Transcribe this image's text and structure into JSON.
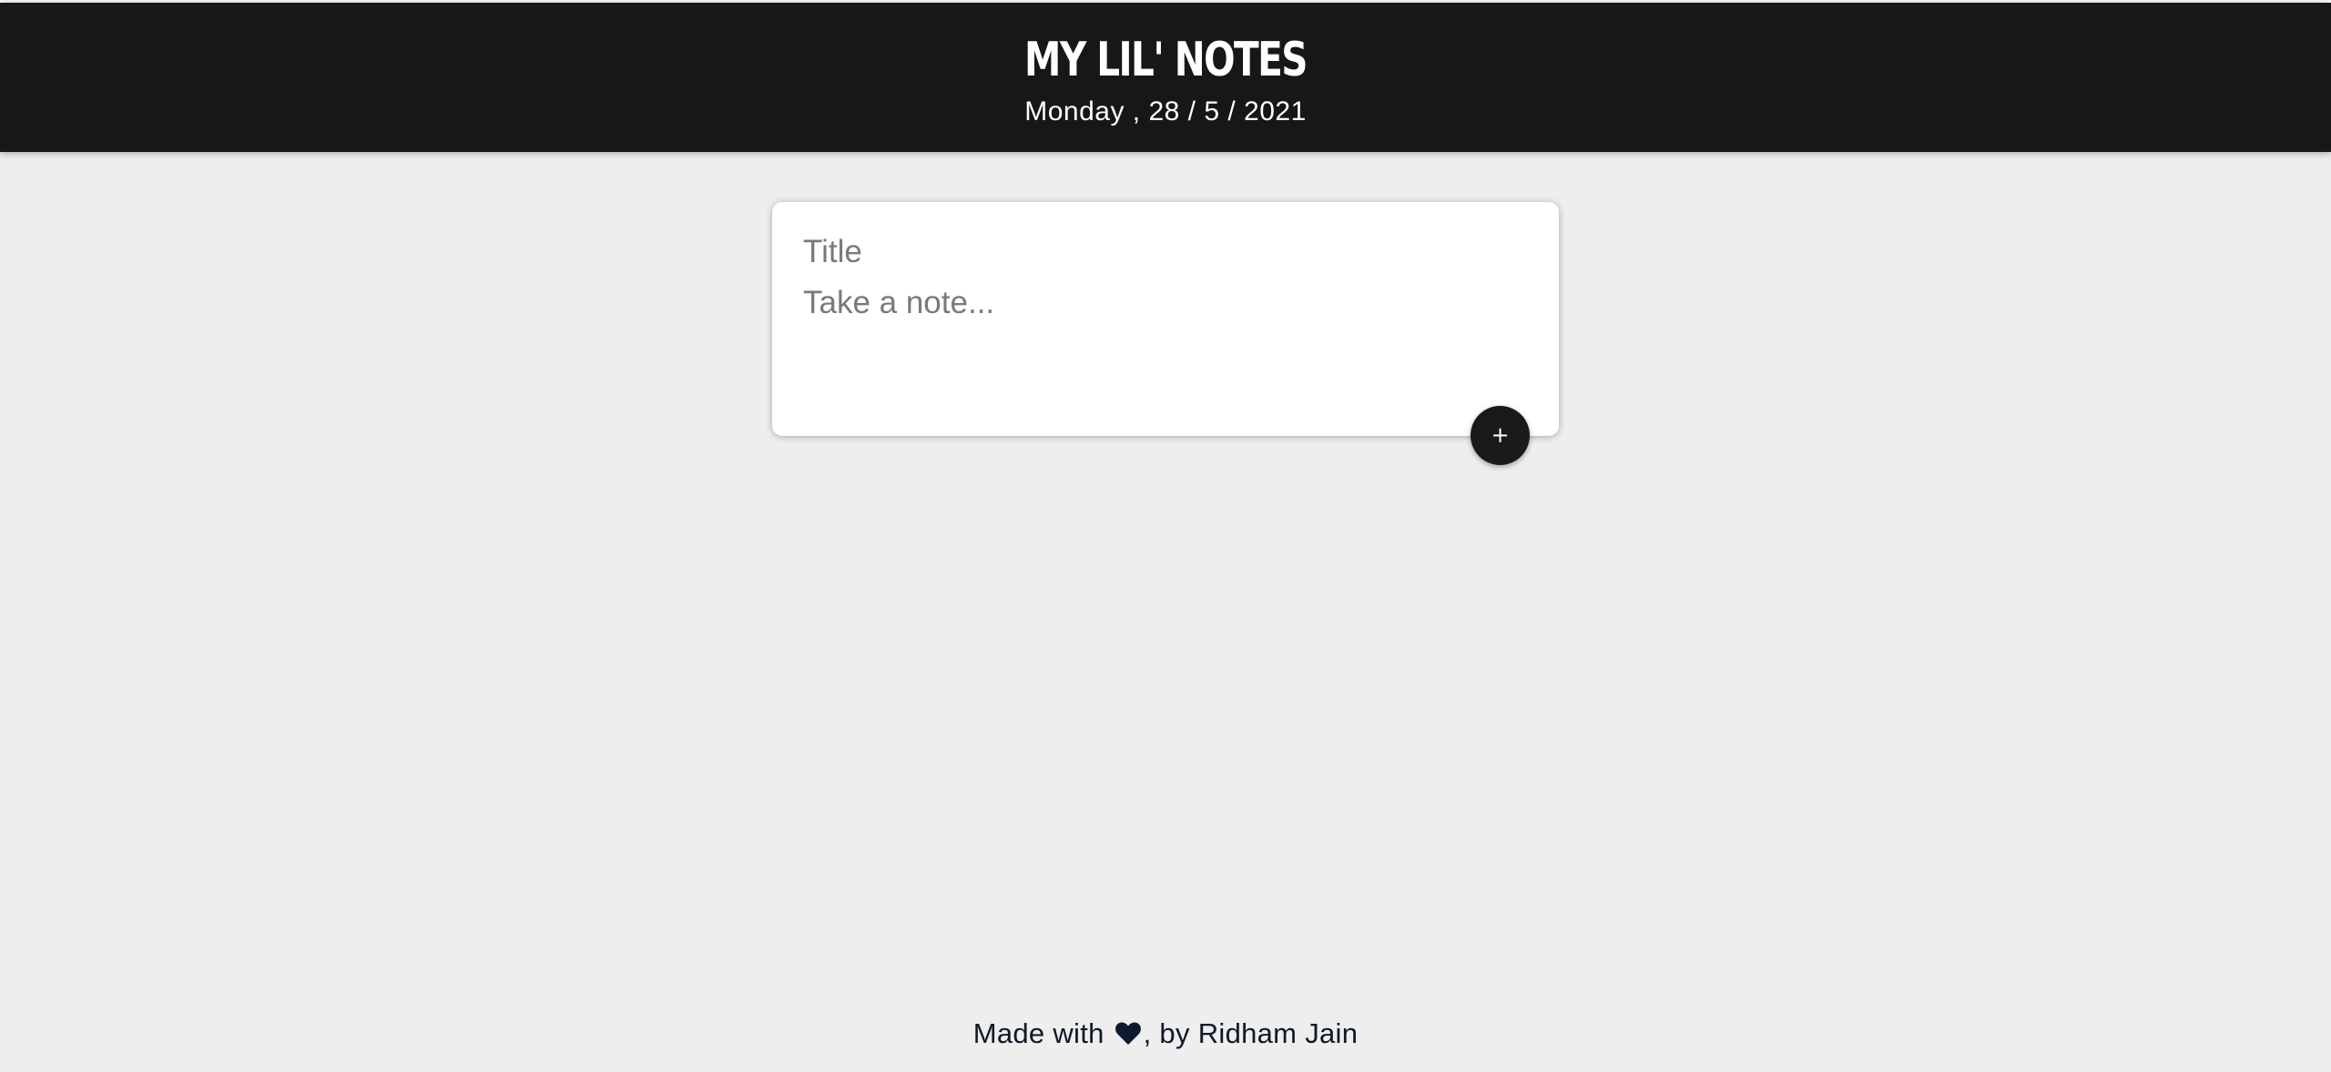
{
  "header": {
    "title": "MY LIL' NOTES",
    "date": "Monday , 28 / 5 / 2021"
  },
  "note_form": {
    "title_placeholder": "Title",
    "content_placeholder": "Take a note...",
    "add_button_label": "+"
  },
  "footer": {
    "prefix": "Made with ",
    "heart_icon": "heart-icon",
    "suffix": ", by Ridham Jain"
  },
  "colors": {
    "header_bg": "#171717",
    "page_bg": "#eeeeee",
    "button_bg": "#1a1a1a",
    "heart": "#0f1a2e"
  }
}
